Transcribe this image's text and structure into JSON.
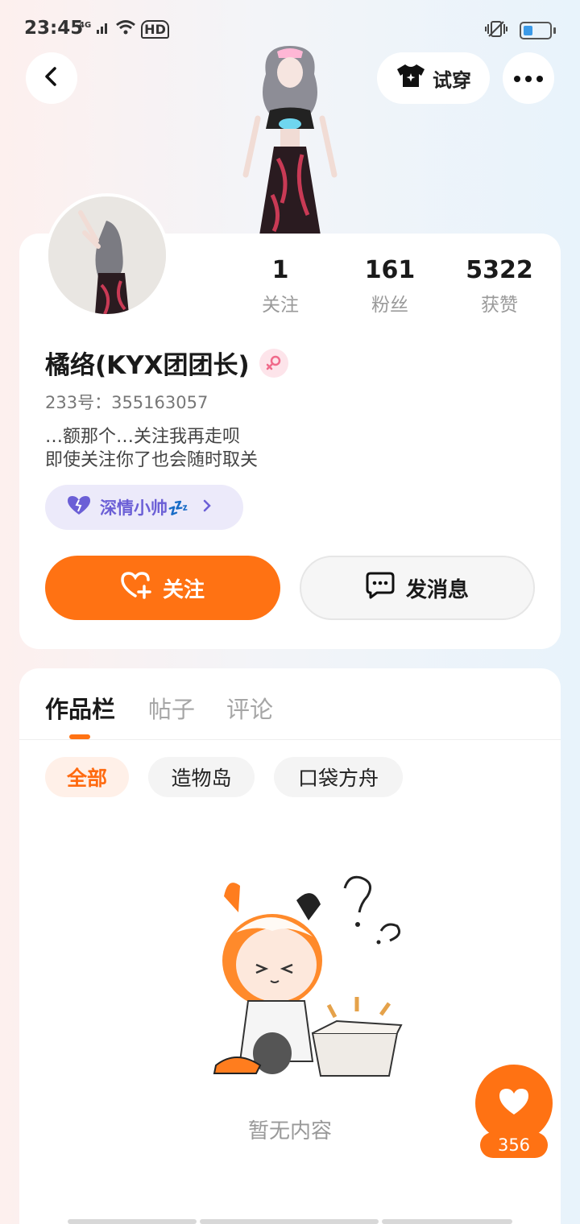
{
  "status_bar": {
    "time": "23:45",
    "network": "4G",
    "hd": "HD"
  },
  "header": {
    "try_on_label": "试穿"
  },
  "stats": [
    {
      "value": "1",
      "label": "关注"
    },
    {
      "value": "161",
      "label": "粉丝"
    },
    {
      "value": "5322",
      "label": "获赞"
    }
  ],
  "profile": {
    "username": "橘络(KYX团团长)",
    "uid": "233号：355163057",
    "bio_line1": "…额那个…关注我再走呗",
    "bio_line2": "即使关注你了也会随时取关",
    "title_badge": "深情小帅💤"
  },
  "actions": {
    "follow_label": "关注",
    "message_label": "发消息"
  },
  "tabs": [
    {
      "label": "作品栏",
      "active": true
    },
    {
      "label": "帖子",
      "active": false
    },
    {
      "label": "评论",
      "active": false
    }
  ],
  "filters": [
    {
      "label": "全部",
      "active": true
    },
    {
      "label": "造物岛",
      "active": false
    },
    {
      "label": "口袋方舟",
      "active": false
    }
  ],
  "empty_state": {
    "text": "暂无内容"
  },
  "like": {
    "count": "356"
  },
  "colors": {
    "accent": "#ff7213",
    "badge_purple": "#6b5fd6"
  }
}
